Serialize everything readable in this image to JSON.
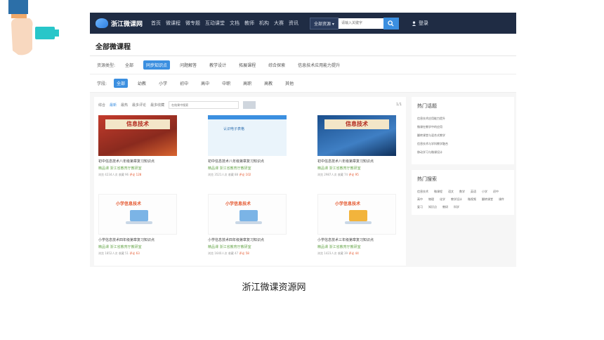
{
  "header": {
    "logo_text": "浙江微课网",
    "nav": [
      "首页",
      "微课程",
      "微专题",
      "互动课堂",
      "文档",
      "教师",
      "机构",
      "大赛",
      "资讯"
    ],
    "search_scope": "全部资源 ▾",
    "search_placeholder": "请输入关键字",
    "login_label": "登录"
  },
  "page_title": "全部微课程",
  "filters": {
    "type": {
      "label": "资源类型:",
      "options": [
        "全部",
        "同步知识点",
        "问题解答",
        "教学设计",
        "拓展课程",
        "综合探索",
        "信息技术应用能力提升"
      ],
      "active": 1
    },
    "stage": {
      "label": "学段:",
      "options": [
        "全部",
        "幼教",
        "小学",
        "初中",
        "高中",
        "中职",
        "高职",
        "高教",
        "其他"
      ],
      "active": 0
    }
  },
  "sort": {
    "items": [
      "综合",
      "最新",
      "最热",
      "最多评论",
      "最多收藏"
    ],
    "active": 1,
    "search_placeholder": "在结果中搜索",
    "pager": "1/1"
  },
  "courses": [
    {
      "theme": "red",
      "banner": "信息技术",
      "title": "初中信息技术八年级第章复习知识点",
      "meta": "精品课  浙江省教育厅教研室",
      "stats": "浏览 4234人次   收藏 96",
      "hot": "评论 128"
    },
    {
      "theme": "light",
      "banner": "",
      "caption": "认识电子表格",
      "title": "初中信息技术八年级第章复习知识点",
      "meta": "精品课  浙江省教育厅教研室",
      "stats": "浏览 3521人次   收藏 88",
      "hot": "评论 102"
    },
    {
      "theme": "blue",
      "banner": "信息技术",
      "title": "初中信息技术八年级第章复习知识点",
      "meta": "精品课  浙江省教育厅教研室",
      "stats": "浏览 2987人次   收藏 74",
      "hot": "评论 95"
    },
    {
      "theme": "white",
      "banner": "",
      "caption": "小学信息技术",
      "title": "小学信息技术四年级第章复习知识点",
      "meta": "精品课  浙江省教育厅教研室",
      "stats": "浏览 1852人次   收藏 51",
      "hot": "评论 63"
    },
    {
      "theme": "white",
      "banner": "",
      "caption": "小学信息技术",
      "title": "小学信息技术四年级第章复习知识点",
      "meta": "精品课  浙江省教育厅教研室",
      "stats": "浏览 1640人次   收藏 47",
      "hot": "评论 58"
    },
    {
      "theme": "white",
      "banner": "",
      "caption": "小学信息技术",
      "title": "小学信息技术三年级第章复习知识点",
      "meta": "精品课  浙江省教育厅教研室",
      "stats": "浏览 1423人次   收藏 39",
      "hot": "评论 44"
    }
  ],
  "sidebar": {
    "hot_topics_title": "热门话题",
    "hot_topics": [
      "信息技术应用能力提升",
      "微课在教学中的应用",
      "翻转课堂与混合式教学",
      "信息技术与学科教学融合",
      "移动学习与微课设计"
    ],
    "hot_search_title": "热门搜索",
    "hot_search": [
      "信息技术",
      "微课程",
      "语文",
      "数学",
      "英语",
      "小学",
      "初中",
      "高中",
      "物理",
      "化学",
      "教学设计",
      "微视频",
      "翻转课堂",
      "课件",
      "复习",
      "知识点",
      "教研",
      "科学"
    ]
  },
  "caption": "浙江微课资源网",
  "colors": {
    "header_bg": "#1f2c44",
    "accent": "#3b8fe0"
  }
}
